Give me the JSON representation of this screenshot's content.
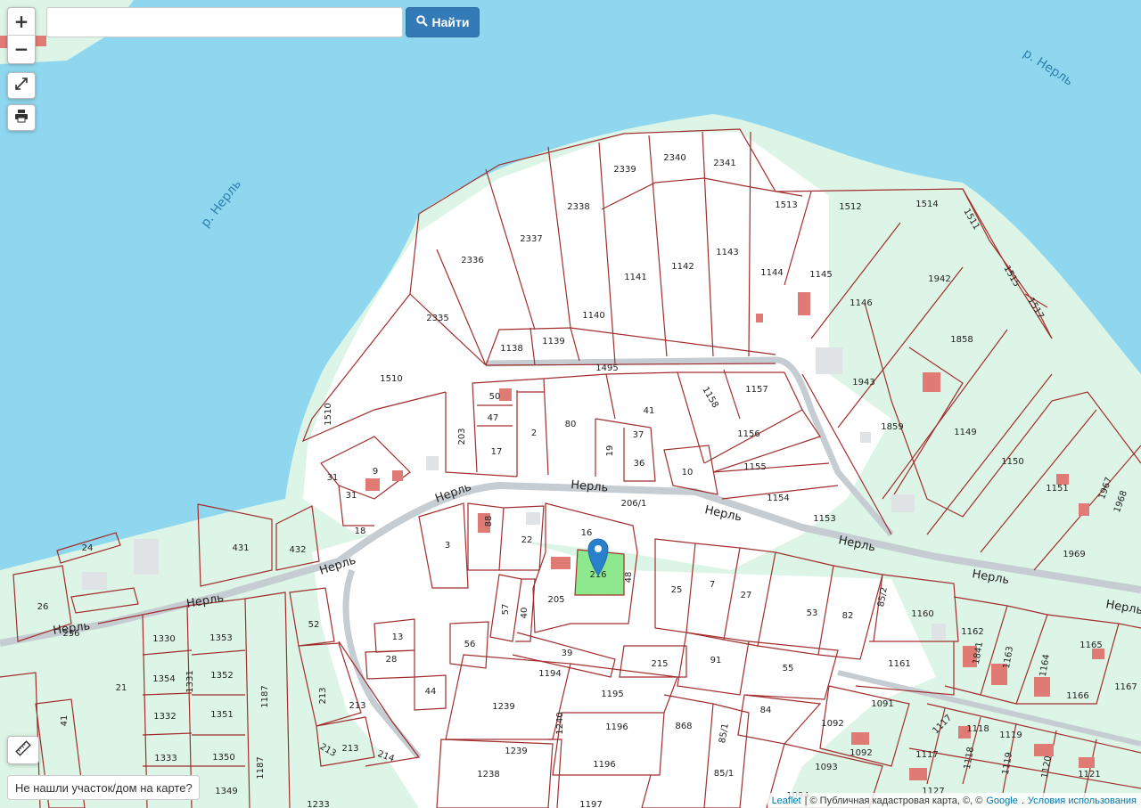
{
  "search": {
    "placeholder": "",
    "value": "",
    "button_label": "Найти"
  },
  "controls": {
    "zoom_in": "+",
    "zoom_out": "−",
    "fullscreen_icon": "expand-icon",
    "print_icon": "printer-icon",
    "measure_icon": "ruler-icon"
  },
  "help_text": "Не нашли участок/дом на карте?",
  "attribution": {
    "leaflet": "Leaflet",
    "source": "| © Публичная кадастровая карта, ©, ©",
    "google": "Google",
    "terms": "Условия использования"
  },
  "colors": {
    "water": "#8fd7ee",
    "land": "#ddf5e6",
    "developed": "#ffffff",
    "parcel_border": "#a12d2d",
    "selected_parcel": "#8ee88e",
    "road": "#c5ccd2",
    "marker": "#2a81cb"
  },
  "map": {
    "river_labels": [
      "р. Нерль",
      "р. Нерль"
    ],
    "street_labels": [
      "Нерль",
      "Нерль",
      "Нерль",
      "Нерль",
      "Нерль",
      "Нерль",
      "Нерль",
      "Нерль"
    ],
    "road_number": "206/1",
    "selected_parcel": "216",
    "parcels": [
      "2339",
      "2340",
      "2341",
      "2338",
      "2337",
      "2336",
      "2335",
      "1141",
      "1142",
      "1143",
      "1140",
      "1138",
      "1139",
      "1495",
      "1513",
      "1512",
      "1514",
      "1511",
      "1515",
      "1517",
      "1144",
      "1145",
      "1146",
      "1942",
      "1858",
      "1510",
      "50",
      "47",
      "17",
      "203",
      "2",
      "80",
      "41",
      "1158",
      "1157",
      "37",
      "19",
      "36",
      "10",
      "1156",
      "1155",
      "1154",
      "1153",
      "1943",
      "1859",
      "1149",
      "1150",
      "1151",
      "1967",
      "1968",
      "1969",
      "31",
      "9",
      "31",
      "18",
      "88",
      "22",
      "16",
      "3",
      "205",
      "48",
      "25",
      "7",
      "27",
      "53",
      "82",
      "85/2",
      "1160",
      "24",
      "431",
      "432",
      "26",
      "256",
      "52",
      "57",
      "40",
      "56",
      "13",
      "28",
      "44",
      "39",
      "215",
      "91",
      "55",
      "84",
      "1194",
      "1195",
      "1239",
      "1240",
      "1196",
      "1196",
      "868",
      "85/1",
      "85/1",
      "1238",
      "1239",
      "1197",
      "1161",
      "1162",
      "1841",
      "1163",
      "1164",
      "1165",
      "1166",
      "1167",
      "1091",
      "1092",
      "1092",
      "1093",
      "1117",
      "1118",
      "1119",
      "1117",
      "1118",
      "1119",
      "1120",
      "1121",
      "1127",
      "1330",
      "1353",
      "1354",
      "1331",
      "1352",
      "1332",
      "1351",
      "1333",
      "1350",
      "1349",
      "1187",
      "1187",
      "21",
      "41",
      "213",
      "213",
      "213",
      "214",
      "1233",
      "1094"
    ]
  }
}
